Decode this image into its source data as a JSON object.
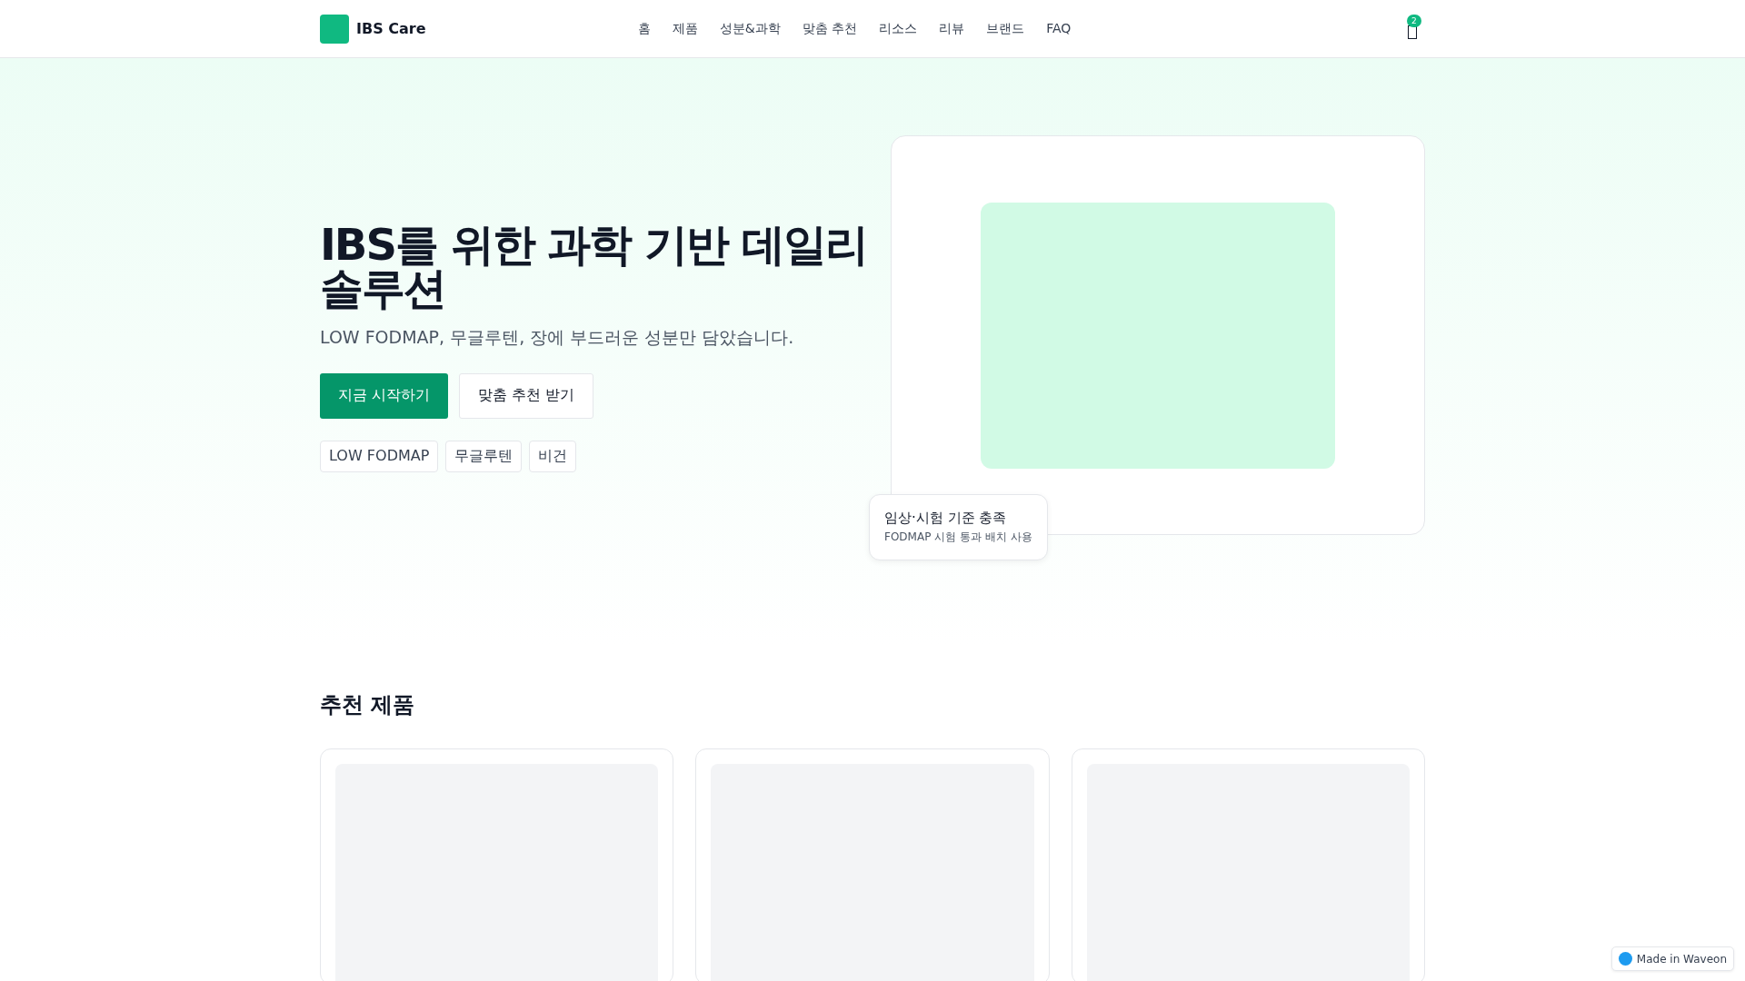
{
  "header": {
    "logo": {
      "text": "IBS Care"
    },
    "nav": [
      {
        "label": "홈"
      },
      {
        "label": "제품"
      },
      {
        "label": "성분&과학"
      },
      {
        "label": "맞춤 추천"
      },
      {
        "label": "리소스"
      },
      {
        "label": "리뷰"
      },
      {
        "label": "브랜드"
      },
      {
        "label": "FAQ"
      }
    ],
    "cart": {
      "count": "2"
    }
  },
  "hero": {
    "title": "IBS를 위한 과학 기반 데일리 솔루션",
    "subtitle": "LOW FODMAP, 무글루텐, 장에 부드러운 성분만 담았습니다.",
    "buttons": [
      {
        "label": "지금 시작하기",
        "kind": "primary"
      },
      {
        "label": "맞춤 추천 받기",
        "kind": "secondary"
      }
    ],
    "tags": [
      "LOW FODMAP",
      "무글루텐",
      "비건"
    ],
    "image": {
      "kind": "placeholder"
    },
    "note": {
      "title": "임상·시험 기준 충족",
      "text": "FODMAP 시험 통과 배치 사용"
    }
  },
  "products": {
    "title": "추천 제품",
    "cards": [
      {
        "kind": "placeholder"
      },
      {
        "kind": "placeholder"
      },
      {
        "kind": "placeholder"
      }
    ]
  },
  "builder_badge": {
    "text": "Made in Waveon"
  }
}
